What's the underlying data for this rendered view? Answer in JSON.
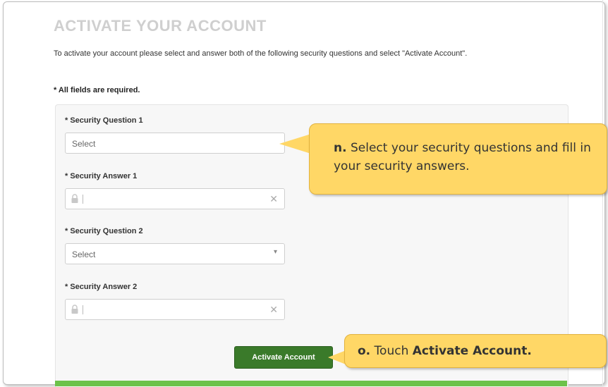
{
  "page": {
    "title": "ACTIVATE YOUR ACCOUNT",
    "intro": "To activate your account please select and answer both of the following security questions and select \"Activate Account\".",
    "required_note": "* All fields are required."
  },
  "form": {
    "q1_label": "* Security Question 1",
    "q1_value": "Select",
    "a1_label": "* Security Answer 1",
    "q2_label": "* Security Question 2",
    "q2_value": "Select",
    "a2_label": "* Security Answer 2",
    "submit_label": "Activate Account"
  },
  "icons": {
    "lock": "lock-icon",
    "clear": "close-icon",
    "dropdown": "chevron-down-icon"
  },
  "callouts": {
    "n_letter": "n.",
    "n_text": "Select your security questions and fill in your security answers.",
    "o_letter": "o.",
    "o_text_pre": "Touch",
    "o_text_bold": "Activate Account."
  },
  "colors": {
    "button": "#3a7a2a",
    "callout": "#ffd766",
    "accent_bar": "#6cc24a",
    "title": "#cfcfcf"
  }
}
